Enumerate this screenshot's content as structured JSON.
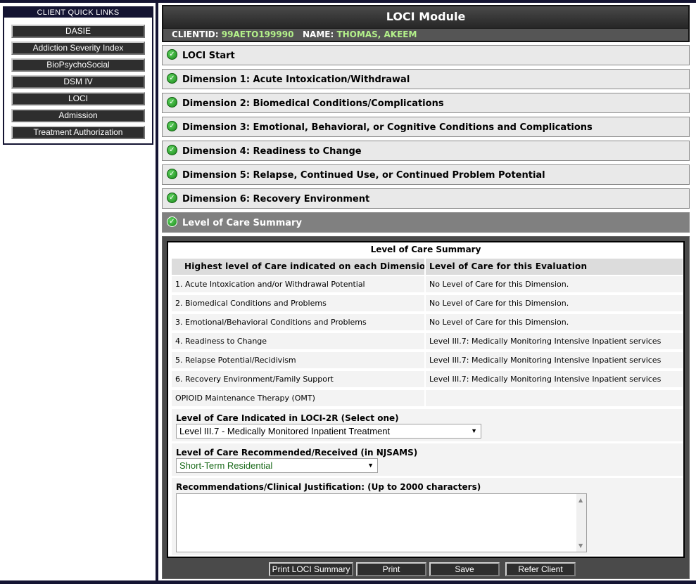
{
  "quick_links": {
    "title": "CLIENT QUICK LINKS",
    "items": [
      "DASIE",
      "Addiction Severity Index",
      "BioPsychoSocial",
      "DSM IV",
      "LOCI",
      "Admission",
      "Treatment Authorization"
    ]
  },
  "module": {
    "title": "LOCI Module",
    "client_id_label": "CLIENTID:",
    "client_id": "99AETO199990",
    "name_label": "NAME:",
    "name": "THOMAS, AKEEM"
  },
  "sections": [
    {
      "label": "LOCI Start",
      "complete": true
    },
    {
      "label": "Dimension 1: Acute Intoxication/Withdrawal",
      "complete": true
    },
    {
      "label": "Dimension 2: Biomedical Conditions/Complications",
      "complete": true
    },
    {
      "label": "Dimension 3: Emotional, Behavioral, or Cognitive Conditions and Complications",
      "complete": true
    },
    {
      "label": "Dimension 4: Readiness to Change",
      "complete": true
    },
    {
      "label": "Dimension 5: Relapse, Continued Use, or Continued Problem Potential",
      "complete": true
    },
    {
      "label": "Dimension 6: Recovery Environment",
      "complete": true
    },
    {
      "label": "Level of Care Summary",
      "complete": true,
      "active": true
    }
  ],
  "summary": {
    "title": "Level of Care Summary",
    "col_headers": [
      "Highest level of Care indicated on each Dimension",
      "Level of Care for this Evaluation"
    ],
    "rows": [
      {
        "dimension": "1. Acute Intoxication and/or Withdrawal Potential",
        "level": "No Level of Care for this Dimension."
      },
      {
        "dimension": "2. Biomedical Conditions and Problems",
        "level": "No Level of Care for this Dimension."
      },
      {
        "dimension": "3. Emotional/Behavioral Conditions and Problems",
        "level": "No Level of Care for this Dimension."
      },
      {
        "dimension": "4. Readiness to Change",
        "level": "Level III.7: Medically Monitoring Intensive Inpatient services"
      },
      {
        "dimension": "5. Relapse Potential/Recidivism",
        "level": "Level III.7: Medically Monitoring Intensive Inpatient services"
      },
      {
        "dimension": "6. Recovery Environment/Family Support",
        "level": "Level III.7: Medically Monitoring Intensive Inpatient services"
      },
      {
        "dimension": "OPIOID Maintenance Therapy (OMT)",
        "level": ""
      }
    ],
    "loci_select_label": "Level of Care Indicated in LOCI-2R (Select one)",
    "loci_select_value": "Level III.7 - Medically Monitored Inpatient Treatment",
    "njsams_select_label": "Level of Care Recommended/Received (in NJSAMS)",
    "njsams_select_value": "Short-Term Residential",
    "justification_label": "Recommendations/Clinical Justification: (Up to 2000 characters)",
    "justification_value": ""
  },
  "buttons": {
    "print_summary": "Print LOCI Summary",
    "print": "Print",
    "save": "Save",
    "refer": "Refer Client"
  },
  "colors": {
    "frame": "#141432",
    "complete_check": "#1a8a1a",
    "client_value": "#b3f08a",
    "njsams_value": "#1a6a1a"
  }
}
